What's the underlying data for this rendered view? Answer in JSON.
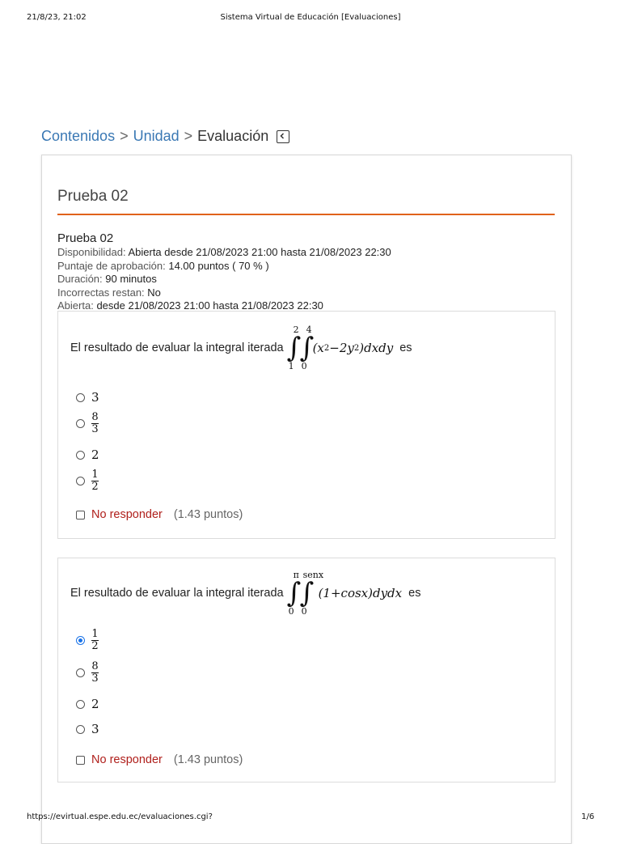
{
  "print": {
    "datetime": "21/8/23, 21:02",
    "page_title": "Sistema Virtual de Educación [Evaluaciones]",
    "url": "https://evirtual.espe.edu.ec/evaluaciones.cgi?",
    "page_count": "1/6"
  },
  "breadcrumb": {
    "contenidos": "Contenidos",
    "unidad": "Unidad",
    "separator": ">",
    "current": "Evaluación"
  },
  "panel": {
    "title": "Prueba 02",
    "info": {
      "name": "Prueba 02",
      "disponibilidad_label": "Disponibilidad:",
      "disponibilidad_value": "Abierta desde 21/08/2023 21:00 hasta 21/08/2023 22:30",
      "puntaje_label": "Puntaje de aprobación:",
      "puntaje_value": "14.00 puntos ( 70 % )",
      "duracion_label": "Duración:",
      "duracion_value": "90 minutos",
      "incorrectas_label": "Incorrectas restan:",
      "incorrectas_value": "No",
      "abierta_label": "Abierta:",
      "abierta_value": "desde 21/08/2023 21:00 hasta 21/08/2023 22:30"
    }
  },
  "questions": [
    {
      "prompt": "El resultado de evaluar la integral iterada",
      "suffix": "es",
      "integral": {
        "outer_upper": "2",
        "outer_lower": "1",
        "inner_upper": "4",
        "inner_lower": "0",
        "integrand_a": "(x",
        "exp_a": "2",
        "integrand_b": "−2y",
        "exp_b": "2",
        "integrand_c": ")dxdy"
      },
      "options": [
        {
          "type": "number",
          "text": "3",
          "checked": false
        },
        {
          "type": "fraction",
          "num": "8",
          "den": "3",
          "checked": false
        },
        {
          "type": "number",
          "text": "2",
          "checked": false
        },
        {
          "type": "fraction",
          "num": "1",
          "den": "2",
          "checked": false
        }
      ],
      "no_responder": "No responder",
      "points": "(1.43 puntos)"
    },
    {
      "prompt": "El resultado de evaluar la integral iterada",
      "suffix": "es",
      "integral": {
        "outer_upper": "π",
        "outer_lower": "0",
        "inner_upper": "senx",
        "inner_lower": "0",
        "integrand": "(1+cosx)dydx"
      },
      "options": [
        {
          "type": "fraction",
          "num": "1",
          "den": "2",
          "checked": true
        },
        {
          "type": "fraction",
          "num": "8",
          "den": "3",
          "checked": false
        },
        {
          "type": "number",
          "text": "2",
          "checked": false
        },
        {
          "type": "number",
          "text": "3",
          "checked": false
        }
      ],
      "no_responder": "No responder",
      "points": "(1.43 puntos)"
    }
  ],
  "colors": {
    "link": "#3a78b4",
    "accent_rule": "#e0621a",
    "no_responder": "#b0201c",
    "radio_checked": "#1a73e8"
  }
}
